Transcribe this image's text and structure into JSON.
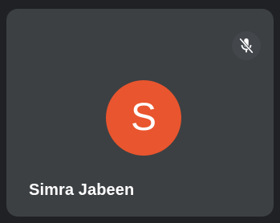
{
  "participant": {
    "name": "Simra Jabeen",
    "initial": "S",
    "avatar_color": "#e9552e",
    "mute_icon": "mic-off-icon",
    "muted": true
  },
  "colors": {
    "background": "#202124",
    "tile": "#3c4043",
    "mute_badge": "#43474c",
    "text": "#ffffff"
  }
}
